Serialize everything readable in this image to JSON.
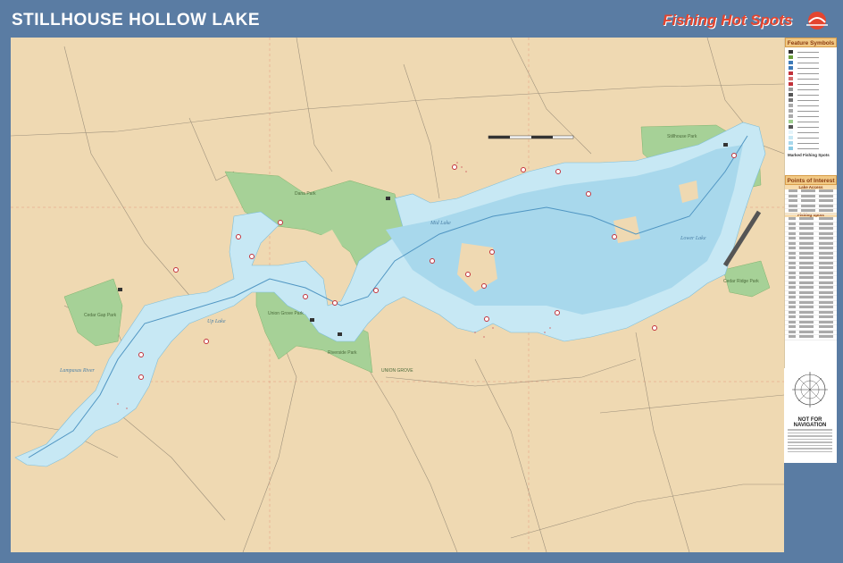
{
  "header": {
    "title": "STILLHOUSE HOLLOW LAKE",
    "brand": "Fishing Hot Spots"
  },
  "legend": {
    "feature_symbols_title": "Feature Symbols",
    "points_of_interest_title": "Points of Interest",
    "lake_access_title": "Lake Access",
    "fishing_spots_title": "Fishing Spots",
    "marked_spots_title": "Marked Fishing Spots",
    "not_for_navigation": "NOT FOR NAVIGATION"
  },
  "map_labels": {
    "union_grove": "UNION GROVE",
    "lake_labels": [
      "Up Lake",
      "Mid Lake",
      "Lower Lake"
    ],
    "river_label": "Lampasas River",
    "park_labels": [
      "Cedar Gap Park",
      "Union Grove Park",
      "Dana Park",
      "Stillhouse Park",
      "Cedar Ridge Park",
      "Riverside Park"
    ]
  },
  "colors": {
    "frame": "#5a7ca3",
    "land": "#efd9b2",
    "water": "#bfe3f1",
    "park": "#9fcf8f",
    "brand": "#e4452f"
  }
}
